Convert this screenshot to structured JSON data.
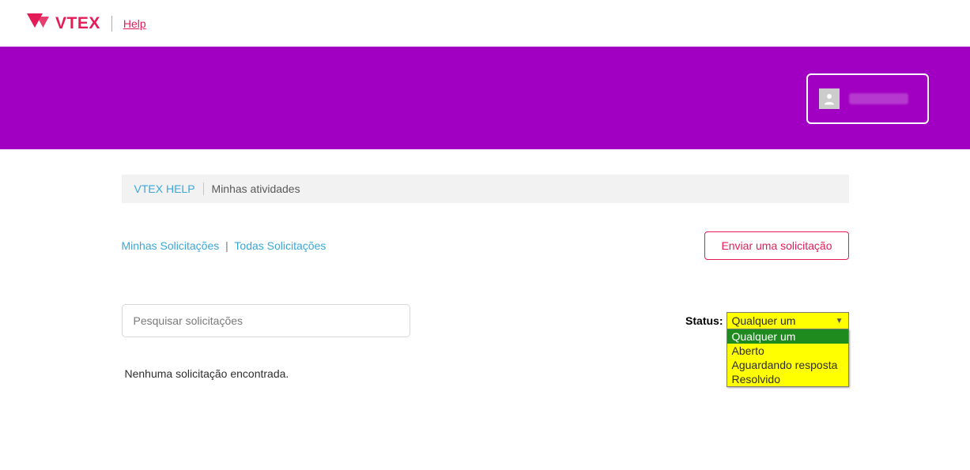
{
  "topbar": {
    "brand": "VTEX",
    "help_link": "Help"
  },
  "banner": {},
  "breadcrumb": {
    "root": "VTEX HELP",
    "current": "Minhas atividades"
  },
  "subnav": {
    "my_requests": "Minhas Solicitações",
    "all_requests": "Todas Solicitações"
  },
  "send_request_btn": "Enviar uma solicitação",
  "search": {
    "placeholder": "Pesquisar solicitações"
  },
  "status": {
    "label": "Status:",
    "selected": "Qualquer um",
    "options": [
      "Qualquer um",
      "Aberto",
      "Aguardando resposta",
      "Resolvido"
    ]
  },
  "no_results": "Nenhuma solicitação encontrada."
}
